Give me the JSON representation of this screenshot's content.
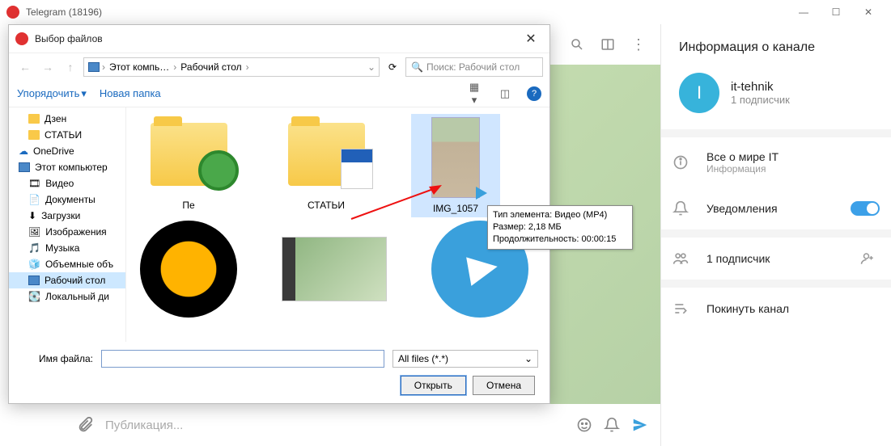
{
  "titlebar": {
    "app_title": "Telegram (18196)"
  },
  "dialog": {
    "title": "Выбор файлов",
    "breadcrumb": {
      "root": "Этот компь…",
      "folder": "Рабочий стол"
    },
    "search_placeholder": "Поиск: Рабочий стол",
    "organize": "Упорядочить",
    "new_folder": "Новая папка",
    "tree": {
      "dzen": "Дзен",
      "stati": "СТАТЬИ",
      "onedrive": "OneDrive",
      "this_pc": "Этот компьютер",
      "video": "Видео",
      "documents": "Документы",
      "downloads": "Загрузки",
      "images": "Изображения",
      "music": "Музыка",
      "volumes": "Объемные объ",
      "desktop": "Рабочий стол",
      "local": "Локальный ди"
    },
    "files": {
      "f1": "Пе",
      "f2": "СТАТЬИ",
      "f3": "IMG_1057"
    },
    "tooltip": {
      "l1": "Тип элемента: Видео (MP4)",
      "l2": "Размер: 2,18 МБ",
      "l3": "Продолжительность: 00:00:15"
    },
    "filename_label": "Имя файла:",
    "filename_value": "",
    "filter": "All files (*.*)",
    "open": "Открыть",
    "cancel": "Отмена"
  },
  "chat": {
    "input_placeholder": "Публикация..."
  },
  "info": {
    "header": "Информация о канале",
    "channel_name": "it-tehnik",
    "subscribers": "1 подписчик",
    "about": "Все о мире IT",
    "about_sub": "Информация",
    "notif": "Уведомления",
    "sub_row": "1 подписчик",
    "leave": "Покинуть канал"
  }
}
